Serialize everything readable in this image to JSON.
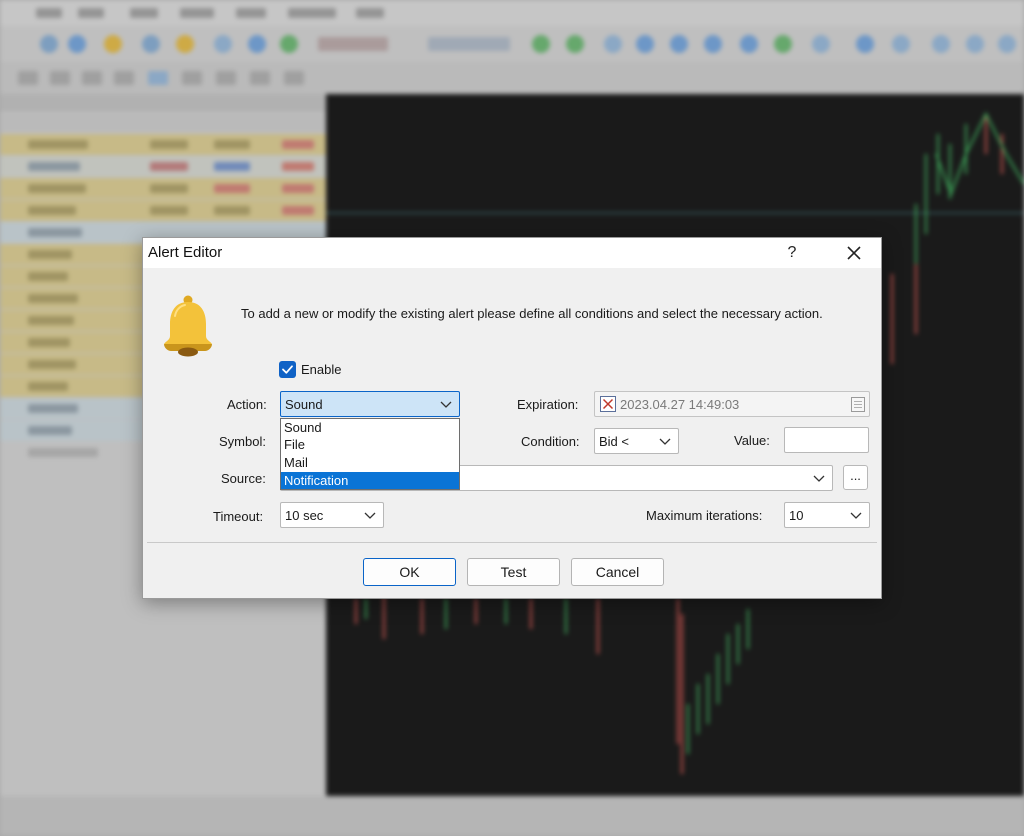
{
  "dialog": {
    "title": "Alert Editor",
    "help_label": "?",
    "description": "To add a new or modify the existing alert please define all conditions and select the necessary action.",
    "enable_label": "Enable",
    "enable_checked": true,
    "action": {
      "label": "Action:",
      "selected": "Sound",
      "options": [
        "Sound",
        "File",
        "Mail",
        "Notification"
      ],
      "highlighted": "Notification"
    },
    "symbol_label": "Symbol:",
    "source_label": "Source:",
    "source_button": "...",
    "timeout": {
      "label": "Timeout:",
      "value": "10 sec"
    },
    "expiration": {
      "label": "Expiration:",
      "value": "2023.04.27 14:49:03"
    },
    "condition": {
      "label": "Condition:",
      "value": "Bid <"
    },
    "value_label": "Value:",
    "max_iterations": {
      "label": "Maximum iterations:",
      "value": "10"
    },
    "buttons": {
      "ok": "OK",
      "test": "Test",
      "cancel": "Cancel"
    }
  },
  "colors": {
    "accent": "#0a74d6",
    "checkbox": "#0f62c6",
    "bell": "#f3c23a",
    "close_x_mark": "#c0392b"
  },
  "icons": [
    "bell-icon",
    "close-icon",
    "help-icon",
    "checkmark-icon",
    "chevron-down-icon",
    "calendar-icon",
    "cross-icon"
  ]
}
